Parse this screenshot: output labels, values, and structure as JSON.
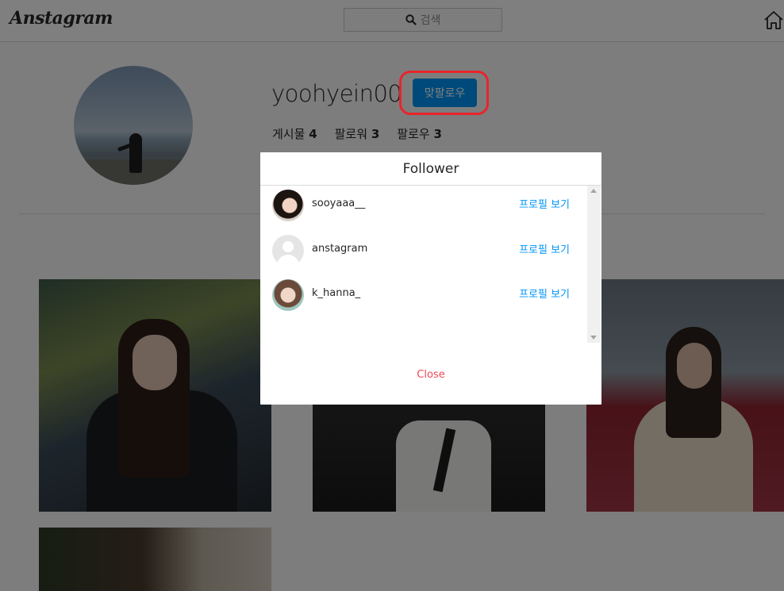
{
  "header": {
    "logo": "Anstagram",
    "search_label": "검색",
    "search_icon": "search-icon",
    "home_icon": "home-icon"
  },
  "profile": {
    "username": "yoohyein00",
    "follow_button": "맞팔로우",
    "stats": [
      {
        "label": "게시물",
        "value": "4"
      },
      {
        "label": "팔로워",
        "value": "3"
      },
      {
        "label": "팔로우",
        "value": "3"
      }
    ]
  },
  "modal": {
    "title": "Follower",
    "followers": [
      {
        "username": "sooyaaa__",
        "action": "프로필 보기"
      },
      {
        "username": "anstagram",
        "action": "프로필 보기"
      },
      {
        "username": "k_hanna_",
        "action": "프로필 보기"
      }
    ],
    "close_label": "Close"
  },
  "colors": {
    "accent": "#0095f6",
    "close": "#ed4956",
    "highlight": "#e8252b"
  }
}
